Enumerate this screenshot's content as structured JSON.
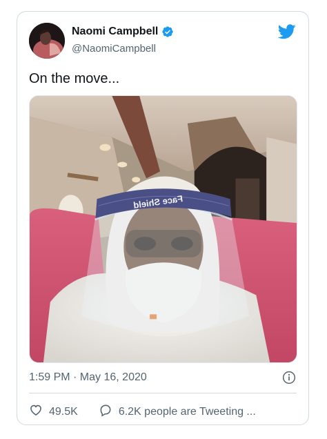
{
  "tweet": {
    "author": {
      "display_name": "Naomi Campbell",
      "handle": "@NaomiCampbell",
      "verified": true
    },
    "text": "On the move...",
    "media": {
      "face_shield_label": "Face Shield"
    },
    "timestamp": "1:59 PM · May 16, 2020",
    "actions": {
      "likes": "49.5K",
      "tweeting": "6.2K people are Tweeting ..."
    }
  },
  "icons": {
    "brand": "twitter-bird-icon",
    "verified": "verified-badge-icon",
    "info": "info-icon",
    "like": "heart-icon",
    "reply": "speech-bubble-icon"
  },
  "colors": {
    "twitter_blue": "#1d9bf0",
    "verified_blue": "#1d9bf0",
    "text_primary": "#0f1419",
    "text_secondary": "#536471",
    "border": "#cfd9de"
  }
}
